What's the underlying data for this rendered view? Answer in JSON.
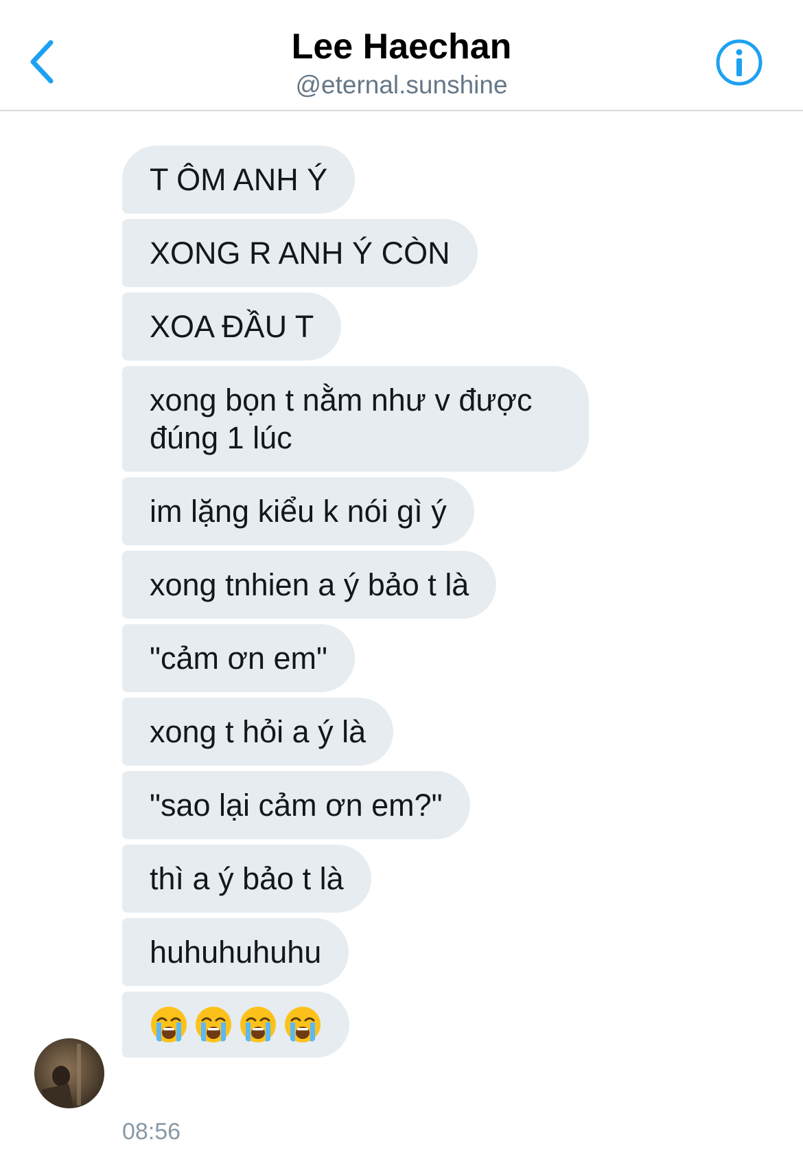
{
  "header": {
    "back_icon": "chevron-left-icon",
    "title": "Lee Haechan",
    "handle": "@eternal.sunshine",
    "info_icon": "info-circle-icon",
    "accent_color": "#1da1f2"
  },
  "messages": [
    {
      "text": "T ÔM ANH Ý"
    },
    {
      "text": "XONG R ANH Ý CÒN"
    },
    {
      "text": "XOA ĐẦU T"
    },
    {
      "text": "xong bọn t nằm như v được đúng 1 lúc"
    },
    {
      "text": "im lặng kiểu k nói gì ý"
    },
    {
      "text": "xong tnhien a ý bảo t là"
    },
    {
      "text": "\"cảm ơn em\""
    },
    {
      "text": "xong t hỏi a ý là"
    },
    {
      "text": "\"sao lại cảm ơn em?\""
    },
    {
      "text": "thì a ý bảo t là"
    },
    {
      "text": "huhuhuhuhu"
    }
  ],
  "emoji_message": {
    "icons": [
      "loudly-crying-face-icon",
      "loudly-crying-face-icon",
      "loudly-crying-face-icon",
      "loudly-crying-face-icon"
    ]
  },
  "sender": {
    "avatar": "avatar"
  },
  "timestamp": "08:56",
  "colors": {
    "bubble_bg": "#e6ecf0",
    "text": "#14171a",
    "secondary_text": "#657786",
    "timestamp": "#8899a6"
  }
}
